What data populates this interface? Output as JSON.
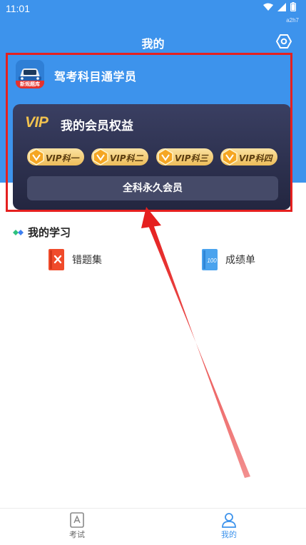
{
  "status_bar": {
    "time": "11:01",
    "tag": "a2h7"
  },
  "header": {
    "title": "我的"
  },
  "user": {
    "name": "驾考科目通学员",
    "avatar_tag": "新规题库"
  },
  "vip": {
    "logo": "VIP",
    "title": "我的会员权益",
    "badges": [
      "VIP科一",
      "VIP科二",
      "VIP科三",
      "VIP科四"
    ],
    "all_button": "全科永久会员"
  },
  "study": {
    "title": "我的学习",
    "items": [
      {
        "label": "错题集",
        "icon": "wrong-questions-icon"
      },
      {
        "label": "成绩单",
        "icon": "score-report-icon"
      }
    ]
  },
  "nav": {
    "tabs": [
      {
        "label": "考试",
        "icon": "exam-icon"
      },
      {
        "label": "我的",
        "icon": "user-icon"
      }
    ],
    "active_index": 1
  },
  "colors": {
    "header_blue": "#3d93ec",
    "vip_gold": "#f1c24f",
    "annotation_red": "#e5201f",
    "active_tab": "#3d93ec"
  }
}
